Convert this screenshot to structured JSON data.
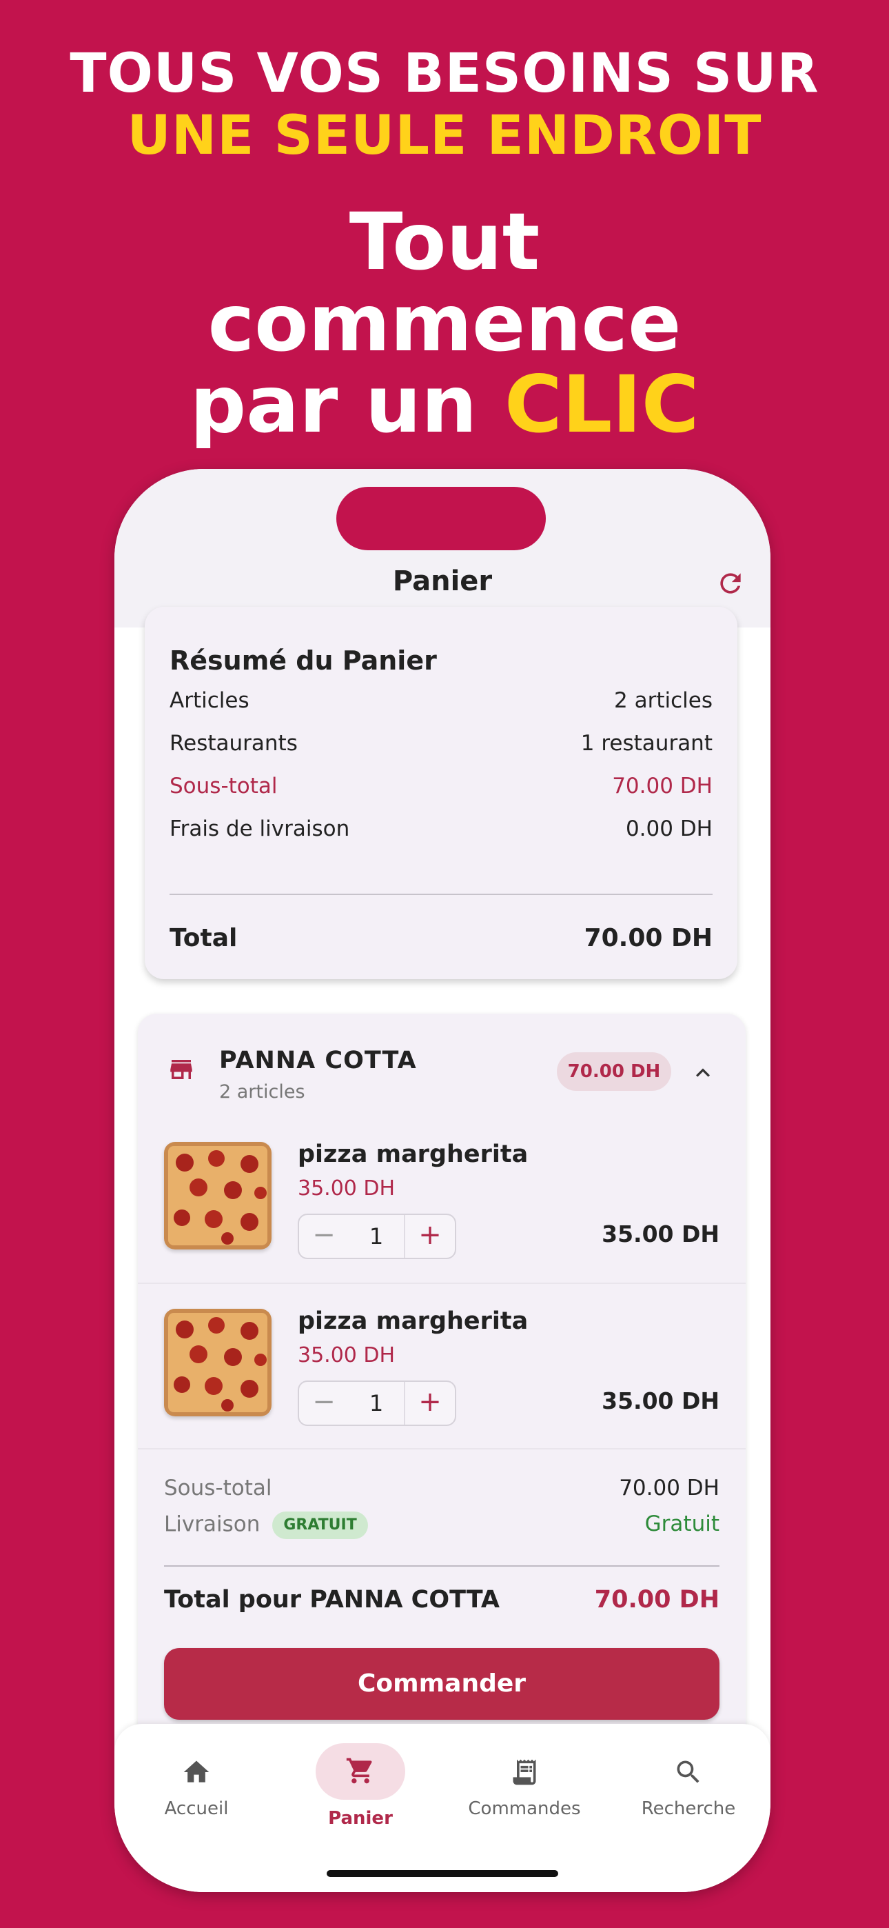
{
  "promo": {
    "headline_line1": "TOUS VOS BESOINS SUR",
    "headline_line2": "UNE SEULE ENDROIT",
    "tagline_line1": "Tout",
    "tagline_line2": "commence",
    "tagline_line3_prefix": "par un",
    "tagline_line3_accent": "CLIC"
  },
  "colors": {
    "background": "#c2134d",
    "accent_yellow": "#ffd21a",
    "brand": "#b72b48",
    "brand_text": "#b0284a",
    "free_green": "#2e8b3a"
  },
  "header": {
    "title": "Panier",
    "refresh_icon": "refresh-icon"
  },
  "summary": {
    "title": "Résumé du Panier",
    "rows": [
      {
        "label": "Articles",
        "value": "2 articles"
      },
      {
        "label": "Restaurants",
        "value": "1 restaurant"
      },
      {
        "label": "Sous-total",
        "value": "70.00 DH"
      },
      {
        "label": "Frais de livraison",
        "value": "0.00 DH"
      }
    ],
    "total_label": "Total",
    "total_value": "70.00 DH"
  },
  "restaurant": {
    "name": "PANNA COTTA",
    "count": "2 articles",
    "price_badge": "70.00 DH",
    "store_icon": "store-icon",
    "items": [
      {
        "name": "pizza margherita",
        "price": "35.00 DH",
        "quantity": "1",
        "line_total": "35.00 DH",
        "minus": "−",
        "plus": "+"
      },
      {
        "name": "pizza margherita",
        "price": "35.00 DH",
        "quantity": "1",
        "line_total": "35.00 DH",
        "minus": "−",
        "plus": "+"
      }
    ],
    "subtotal_label": "Sous-total",
    "subtotal_value": "70.00 DH",
    "delivery_label": "Livraison",
    "delivery_badge": "GRATUIT",
    "delivery_value": "Gratuit",
    "total_label": "Total pour PANNA COTTA",
    "total_value": "70.00 DH",
    "order_button": "Commander"
  },
  "nav": {
    "items": [
      {
        "label": "Accueil",
        "icon": "home-icon"
      },
      {
        "label": "Panier",
        "icon": "cart-icon",
        "active": true
      },
      {
        "label": "Commandes",
        "icon": "receipt-icon"
      },
      {
        "label": "Recherche",
        "icon": "search-icon"
      }
    ]
  }
}
